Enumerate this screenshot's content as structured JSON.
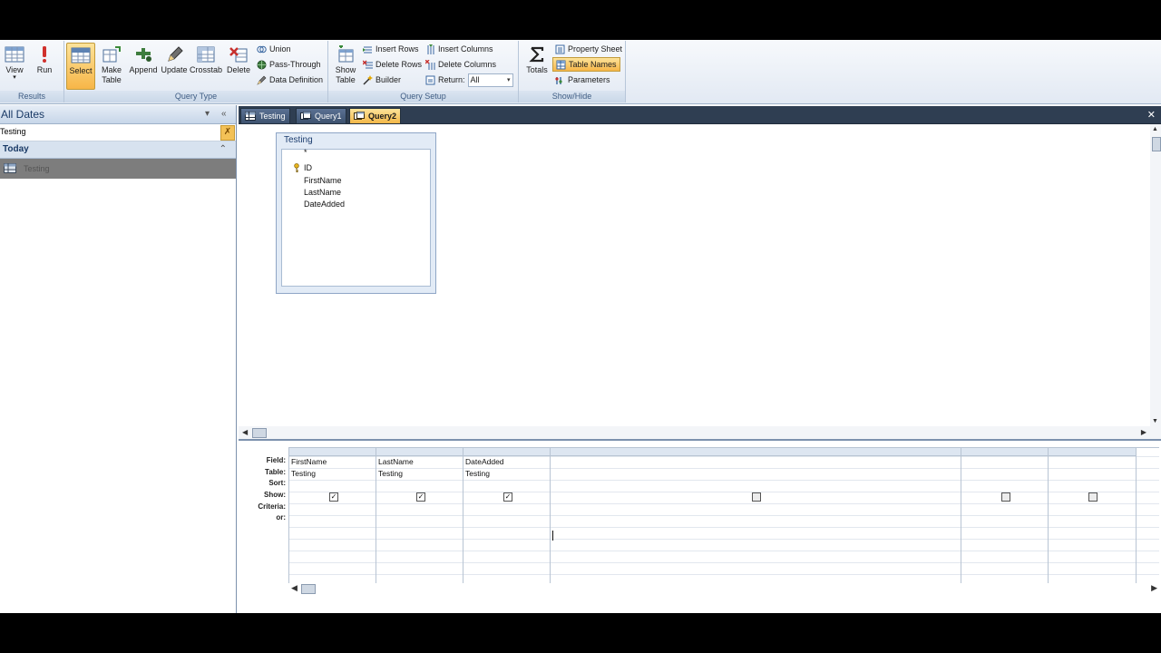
{
  "ribbon": {
    "results": {
      "label": "Results",
      "view": "View",
      "run": "Run"
    },
    "query_type": {
      "label": "Query Type",
      "select": "Select",
      "make_table": "Make Table",
      "append": "Append",
      "update": "Update",
      "crosstab": "Crosstab",
      "delete": "Delete",
      "union": "Union",
      "pass_through": "Pass-Through",
      "data_definition": "Data Definition"
    },
    "query_setup": {
      "label": "Query Setup",
      "show_table": "Show Table",
      "insert_rows": "Insert Rows",
      "delete_rows": "Delete Rows",
      "builder": "Builder",
      "insert_columns": "Insert Columns",
      "delete_columns": "Delete Columns",
      "return_label": "Return:",
      "return_value": "All"
    },
    "show_hide": {
      "label": "Show/Hide",
      "totals": "Totals",
      "property_sheet": "Property Sheet",
      "table_names": "Table Names",
      "parameters": "Parameters"
    }
  },
  "nav": {
    "title": "All Dates",
    "search_value": "Testing",
    "group": "Today",
    "item": "Testing"
  },
  "tabs": [
    "Testing",
    "Query1",
    "Query2"
  ],
  "field_list": {
    "title": "Testing",
    "fields": [
      "*",
      "ID",
      "FirstName",
      "LastName",
      "DateAdded"
    ]
  },
  "grid": {
    "row_labels": [
      "Field:",
      "Table:",
      "Sort:",
      "Show:",
      "Criteria:",
      "or:"
    ],
    "columns": [
      {
        "field": "FirstName",
        "table": "Testing",
        "show": true
      },
      {
        "field": "LastName",
        "table": "Testing",
        "show": true
      },
      {
        "field": "DateAdded",
        "table": "Testing",
        "show": true
      },
      {
        "field": "",
        "table": "",
        "show": false
      },
      {
        "field": "",
        "table": "",
        "show": false
      },
      {
        "field": "",
        "table": "",
        "show": false
      }
    ]
  },
  "colors": {
    "active_highlight": "#f7b648",
    "doc_tabbar": "#2f3e52",
    "ribbon_text": "#3e5c83"
  }
}
